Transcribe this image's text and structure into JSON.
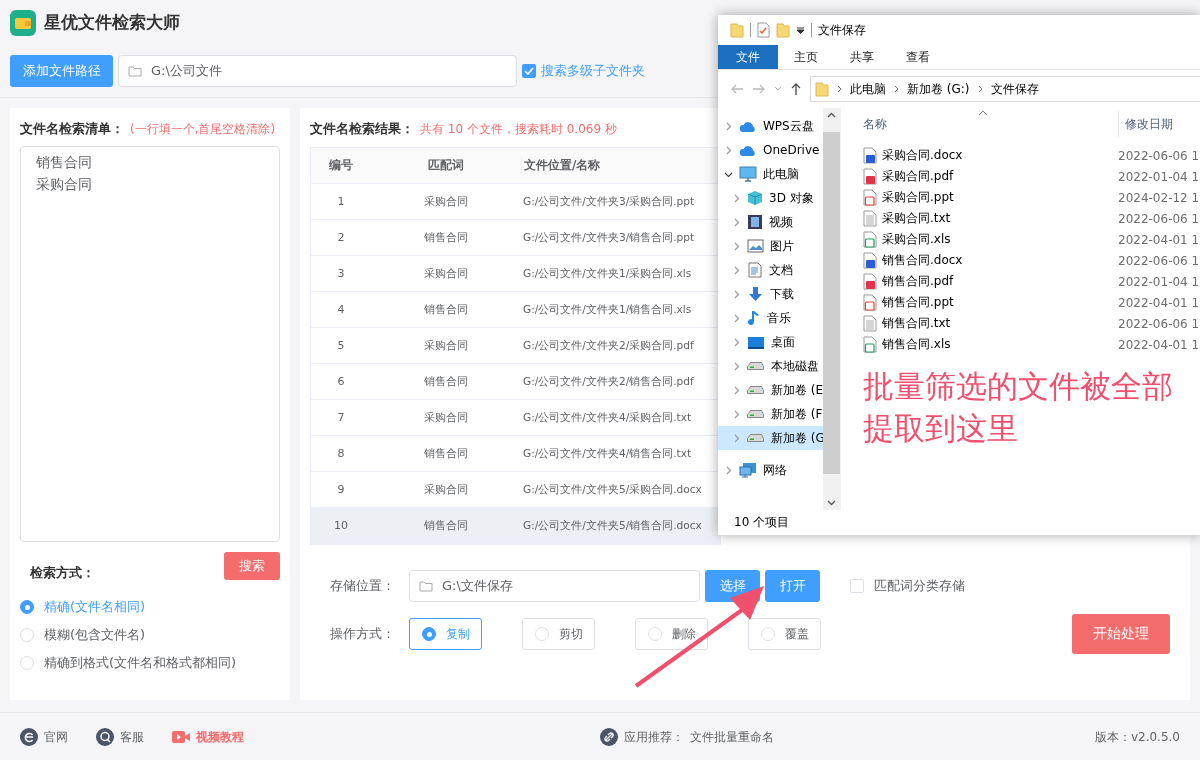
{
  "app": {
    "title": "星优文件检索大师"
  },
  "toolbar": {
    "add_button": "添加文件路径",
    "path_field": {
      "value": "G:\\公司文件"
    },
    "subfolders": {
      "label": "搜索多级子文件夹",
      "checked": true
    }
  },
  "search_list": {
    "title": "文件名检索清单：",
    "hint": "(一行填一个,首尾空格清除)",
    "lines": [
      "销售合同",
      "采购合同"
    ],
    "search_button": "搜索",
    "mode_label": "检索方式：",
    "modes": [
      {
        "label": "精确(文件名相同)",
        "selected": true
      },
      {
        "label": "模糊(包含文件名)",
        "selected": false
      },
      {
        "label": "精确到格式(文件名和格式都相同)",
        "selected": false
      }
    ]
  },
  "results": {
    "title": "文件名检索结果：",
    "summary": "共有 10 个文件，搜索耗时 0.069 秒",
    "columns": [
      "编号",
      "匹配词",
      "文件位置/名称"
    ],
    "rows": [
      {
        "cells": [
          "1",
          "采购合同",
          "G:/公司文件/文件夹3/采购合同.ppt"
        ],
        "selected": false
      },
      {
        "cells": [
          "2",
          "销售合同",
          "G:/公司文件/文件夹3/销售合同.ppt"
        ],
        "selected": false
      },
      {
        "cells": [
          "3",
          "采购合同",
          "G:/公司文件/文件夹1/采购合同.xls"
        ],
        "selected": false
      },
      {
        "cells": [
          "4",
          "销售合同",
          "G:/公司文件/文件夹1/销售合同.xls"
        ],
        "selected": false
      },
      {
        "cells": [
          "5",
          "采购合同",
          "G:/公司文件/文件夹2/采购合同.pdf"
        ],
        "selected": false
      },
      {
        "cells": [
          "6",
          "销售合同",
          "G:/公司文件/文件夹2/销售合同.pdf"
        ],
        "selected": false
      },
      {
        "cells": [
          "7",
          "采购合同",
          "G:/公司文件/文件夹4/采购合同.txt"
        ],
        "selected": false
      },
      {
        "cells": [
          "8",
          "销售合同",
          "G:/公司文件/文件夹4/销售合同.txt"
        ],
        "selected": false
      },
      {
        "cells": [
          "9",
          "采购合同",
          "G:/公司文件/文件夹5/采购合同.docx"
        ],
        "selected": false
      },
      {
        "cells": [
          "10",
          "销售合同",
          "G:/公司文件/文件夹5/销售合同.docx"
        ],
        "selected": true
      }
    ]
  },
  "output": {
    "location_label": "存储位置：",
    "location_field": {
      "value": "G:\\文件保存"
    },
    "choose_button": "选择",
    "open_button": "打开",
    "classify": {
      "label": "匹配词分类存储",
      "checked": false
    },
    "operation_label": "操作方式：",
    "operations": [
      {
        "label": "复制",
        "selected": true
      },
      {
        "label": "剪切",
        "selected": false
      },
      {
        "label": "删除",
        "selected": false
      },
      {
        "label": "覆盖",
        "selected": false
      }
    ],
    "start_button": "开始处理"
  },
  "footer": {
    "links": [
      {
        "label": "官网",
        "kind": "site"
      },
      {
        "label": "客服",
        "kind": "support"
      },
      {
        "label": "视频教程",
        "kind": "video"
      }
    ],
    "recommend_label": "应用推荐：",
    "recommend_link": "文件批量重命名",
    "version": "版本：v2.0.5.0"
  },
  "explorer": {
    "title": "文件保存",
    "ribbon_tabs": [
      {
        "label": "文件",
        "selected": true
      },
      {
        "label": "主页",
        "selected": false
      },
      {
        "label": "共享",
        "selected": false
      },
      {
        "label": "查看",
        "selected": false
      }
    ],
    "breadcrumb": [
      "此电脑",
      "新加卷 (G:)",
      "文件保存"
    ],
    "nav": [
      {
        "label": "WPS云盘",
        "kind": "cloud",
        "expanded": false,
        "selected": false
      },
      {
        "label": "OneDrive",
        "kind": "cloud",
        "expanded": false,
        "selected": false
      },
      {
        "label": "此电脑",
        "kind": "computer",
        "expanded": true,
        "selected": false,
        "children": [
          {
            "label": "3D 对象",
            "kind": "cube",
            "expanded": false,
            "selected": false
          },
          {
            "label": "视频",
            "kind": "video",
            "expanded": false,
            "selected": false
          },
          {
            "label": "图片",
            "kind": "picture",
            "expanded": false,
            "selected": false
          },
          {
            "label": "文档",
            "kind": "document",
            "expanded": false,
            "selected": false
          },
          {
            "label": "下载",
            "kind": "download",
            "expanded": false,
            "selected": false
          },
          {
            "label": "音乐",
            "kind": "music",
            "expanded": false,
            "selected": false
          },
          {
            "label": "桌面",
            "kind": "desktop",
            "expanded": false,
            "selected": false
          },
          {
            "label": "本地磁盘",
            "kind": "drive",
            "expanded": false,
            "selected": false
          },
          {
            "label": "新加卷 (E",
            "kind": "drive",
            "expanded": false,
            "selected": false
          },
          {
            "label": "新加卷 (F",
            "kind": "drive",
            "expanded": false,
            "selected": false
          },
          {
            "label": "新加卷 (G",
            "kind": "drive",
            "expanded": false,
            "selected": true
          }
        ]
      },
      {
        "label": "网络",
        "kind": "network",
        "expanded": false,
        "selected": false
      }
    ],
    "columns": [
      "名称",
      "修改日期"
    ],
    "files": [
      {
        "name": "采购合同.docx",
        "kind": "word",
        "modified": "2022-06-06 1"
      },
      {
        "name": "采购合同.pdf",
        "kind": "pdf",
        "modified": "2022-01-04 1"
      },
      {
        "name": "采购合同.ppt",
        "kind": "ppt",
        "modified": "2024-02-12 1"
      },
      {
        "name": "采购合同.txt",
        "kind": "txt",
        "modified": "2022-06-06 1"
      },
      {
        "name": "采购合同.xls",
        "kind": "xls",
        "modified": "2022-04-01 1"
      },
      {
        "name": "销售合同.docx",
        "kind": "word",
        "modified": "2022-06-06 1"
      },
      {
        "name": "销售合同.pdf",
        "kind": "pdf",
        "modified": "2022-01-04 1"
      },
      {
        "name": "销售合同.ppt",
        "kind": "ppt",
        "modified": "2022-04-01 1"
      },
      {
        "name": "销售合同.txt",
        "kind": "txt",
        "modified": "2022-06-06 1"
      },
      {
        "name": "销售合同.xls",
        "kind": "xls",
        "modified": "2022-04-01 1"
      }
    ],
    "status": "10 个项目"
  },
  "annotation": {
    "text": "批量筛选的文件被全部提取到这里"
  }
}
